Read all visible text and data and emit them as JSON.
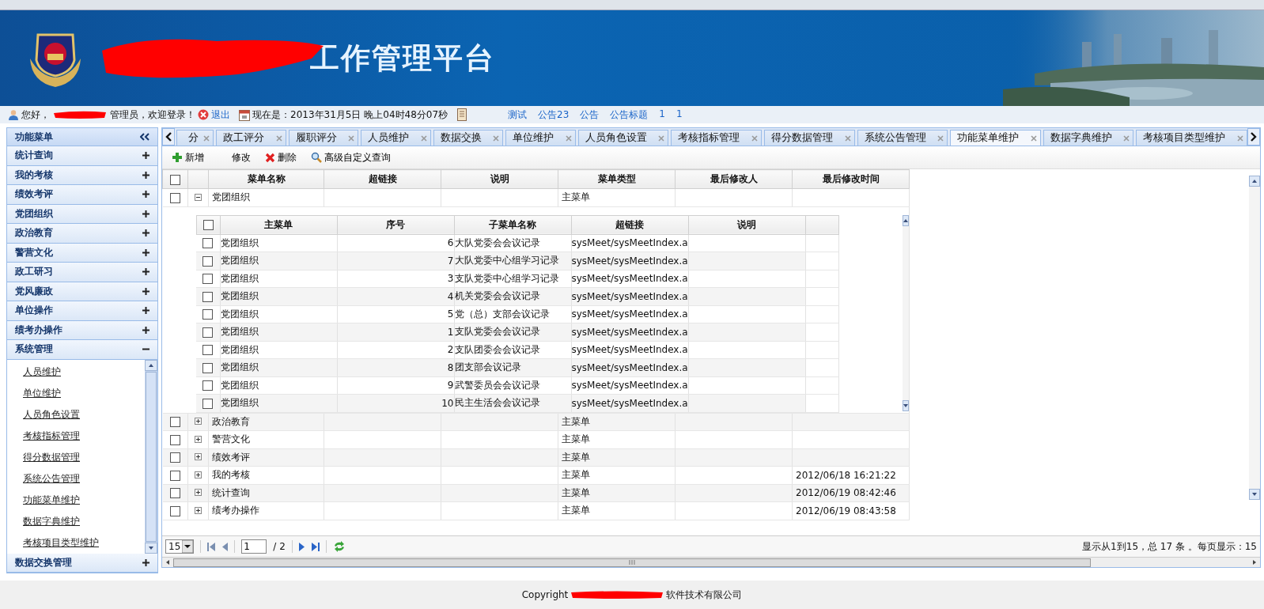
{
  "header": {
    "title": "工作管理平台"
  },
  "info_bar": {
    "greeting": "您好，",
    "role_text": "管理员，欢迎登录！",
    "logout": "退出",
    "now_text": "现在是：2013年31月5日 晚上04时48分07秒",
    "notices": [
      "测试",
      "公告23",
      "公告",
      "公告标题",
      "1",
      "1"
    ]
  },
  "sidebar": {
    "title": "功能菜单",
    "items": [
      {
        "label": "统计查询",
        "expanded": false
      },
      {
        "label": "我的考核",
        "expanded": false
      },
      {
        "label": "绩效考评",
        "expanded": false
      },
      {
        "label": "党团组织",
        "expanded": false
      },
      {
        "label": "政治教育",
        "expanded": false
      },
      {
        "label": "警营文化",
        "expanded": false
      },
      {
        "label": "政工研习",
        "expanded": false
      },
      {
        "label": "党风廉政",
        "expanded": false
      },
      {
        "label": "单位操作",
        "expanded": false
      },
      {
        "label": "绩考办操作",
        "expanded": false
      },
      {
        "label": "系统管理",
        "expanded": true,
        "children": [
          {
            "label": "人员维护"
          },
          {
            "label": "单位维护"
          },
          {
            "label": "人员角色设置"
          },
          {
            "label": "考核指标管理"
          },
          {
            "label": "得分数据管理"
          },
          {
            "label": "系统公告管理"
          },
          {
            "label": "功能菜单维护"
          },
          {
            "label": "数据字典维护"
          },
          {
            "label": "考核项目类型维护"
          }
        ]
      },
      {
        "label": "数据交换管理",
        "expanded": false
      }
    ]
  },
  "tabs": [
    {
      "label": "分",
      "selected": false
    },
    {
      "label": "政工评分",
      "selected": false
    },
    {
      "label": "履职评分",
      "selected": false
    },
    {
      "label": "人员维护",
      "selected": false
    },
    {
      "label": "数据交换",
      "selected": false
    },
    {
      "label": "单位维护",
      "selected": false
    },
    {
      "label": "人员角色设置",
      "selected": false
    },
    {
      "label": "考核指标管理",
      "selected": false
    },
    {
      "label": "得分数据管理",
      "selected": false
    },
    {
      "label": "系统公告管理",
      "selected": false
    },
    {
      "label": "功能菜单维护",
      "selected": true
    },
    {
      "label": "数据字典维护",
      "selected": false
    },
    {
      "label": "考核项目类型维护",
      "selected": false
    }
  ],
  "toolbar": [
    {
      "kind": "add",
      "label": "新增"
    },
    {
      "kind": "edit",
      "label": "修改"
    },
    {
      "kind": "delete",
      "label": "删除"
    },
    {
      "kind": "query",
      "label": "高级自定义查询"
    }
  ],
  "table": {
    "all_checked": false,
    "columns": [
      "菜单名称",
      "超链接",
      "说明",
      "菜单类型",
      "最后修改人",
      "最后修改时间"
    ],
    "rows": [
      {
        "checked": false,
        "expanded": true,
        "menu_name": "党团组织",
        "menu_type": "主菜单"
      },
      {
        "checked": false,
        "expanded": false,
        "menu_name": "政治教育",
        "menu_type": "主菜单"
      },
      {
        "checked": false,
        "expanded": false,
        "menu_name": "警营文化",
        "menu_type": "主菜单"
      },
      {
        "checked": false,
        "expanded": false,
        "menu_name": "绩效考评",
        "menu_type": "主菜单"
      },
      {
        "checked": false,
        "expanded": false,
        "menu_name": "我的考核",
        "menu_type": "主菜单",
        "modified_time": "2012/06/18 16:21:22"
      },
      {
        "checked": false,
        "expanded": false,
        "menu_name": "统计查询",
        "menu_type": "主菜单",
        "modified_time": "2012/06/19 08:42:46"
      },
      {
        "checked": false,
        "expanded": false,
        "menu_name": "绩考办操作",
        "menu_type": "主菜单",
        "modified_time": "2012/06/19 08:43:58"
      }
    ],
    "subtable": {
      "all_checked": false,
      "columns": [
        "主菜单",
        "序号",
        "子菜单名称",
        "超链接",
        "说明"
      ],
      "rows": [
        {
          "checked": false,
          "main_menu": "党团组织",
          "order": "6",
          "submenu_name": "大队党委会会议记录",
          "link": "sysMeet/sysMeetIndex.a"
        },
        {
          "checked": false,
          "main_menu": "党团组织",
          "order": "7",
          "submenu_name": "大队党委中心组学习记录",
          "link": "sysMeet/sysMeetIndex.a"
        },
        {
          "checked": false,
          "main_menu": "党团组织",
          "order": "3",
          "submenu_name": "支队党委中心组学习记录",
          "link": "sysMeet/sysMeetIndex.a"
        },
        {
          "checked": false,
          "main_menu": "党团组织",
          "order": "4",
          "submenu_name": "机关党委会会议记录",
          "link": "sysMeet/sysMeetIndex.a"
        },
        {
          "checked": false,
          "main_menu": "党团组织",
          "order": "5",
          "submenu_name": "党（总）支部会议记录",
          "link": "sysMeet/sysMeetIndex.a"
        },
        {
          "checked": false,
          "main_menu": "党团组织",
          "order": "1",
          "submenu_name": "支队党委会会议记录",
          "link": "sysMeet/sysMeetIndex.a"
        },
        {
          "checked": false,
          "main_menu": "党团组织",
          "order": "2",
          "submenu_name": "支队团委会会议记录",
          "link": "sysMeet/sysMeetIndex.a"
        },
        {
          "checked": false,
          "main_menu": "党团组织",
          "order": "8",
          "submenu_name": "团支部会议记录",
          "link": "sysMeet/sysMeetIndex.a"
        },
        {
          "checked": false,
          "main_menu": "党团组织",
          "order": "9",
          "submenu_name": "武警委员会会议记录",
          "link": "sysMeet/sysMeetIndex.a"
        },
        {
          "checked": false,
          "main_menu": "党团组织",
          "order": "10",
          "submenu_name": "民主生活会会议记录",
          "link": "sysMeet/sysMeetIndex.a"
        }
      ]
    }
  },
  "pager": {
    "page_size": "15",
    "page": "1",
    "total_pages": "/ 2",
    "summary": "显示从1到15，总 17 条 。每页显示：15"
  },
  "footer": {
    "prefix": "Copyright",
    "suffix": "软件技术有限公司"
  }
}
